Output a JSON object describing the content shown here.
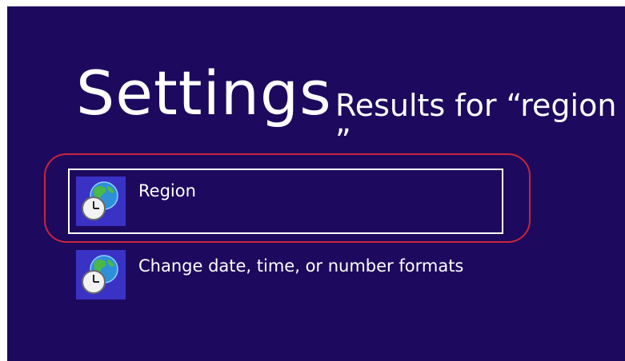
{
  "header": {
    "title": "Settings",
    "subtitle": "Results for “region ”"
  },
  "results": [
    {
      "label": "Region",
      "icon": "region-clock-globe-icon",
      "selected": true
    },
    {
      "label": "Change date, time, or number formats",
      "icon": "region-clock-globe-icon",
      "selected": false
    }
  ],
  "colors": {
    "background": "#1d0a5e",
    "tile": "#3a32c4",
    "highlight_ring": "#c8253a",
    "text": "#ffffff"
  }
}
